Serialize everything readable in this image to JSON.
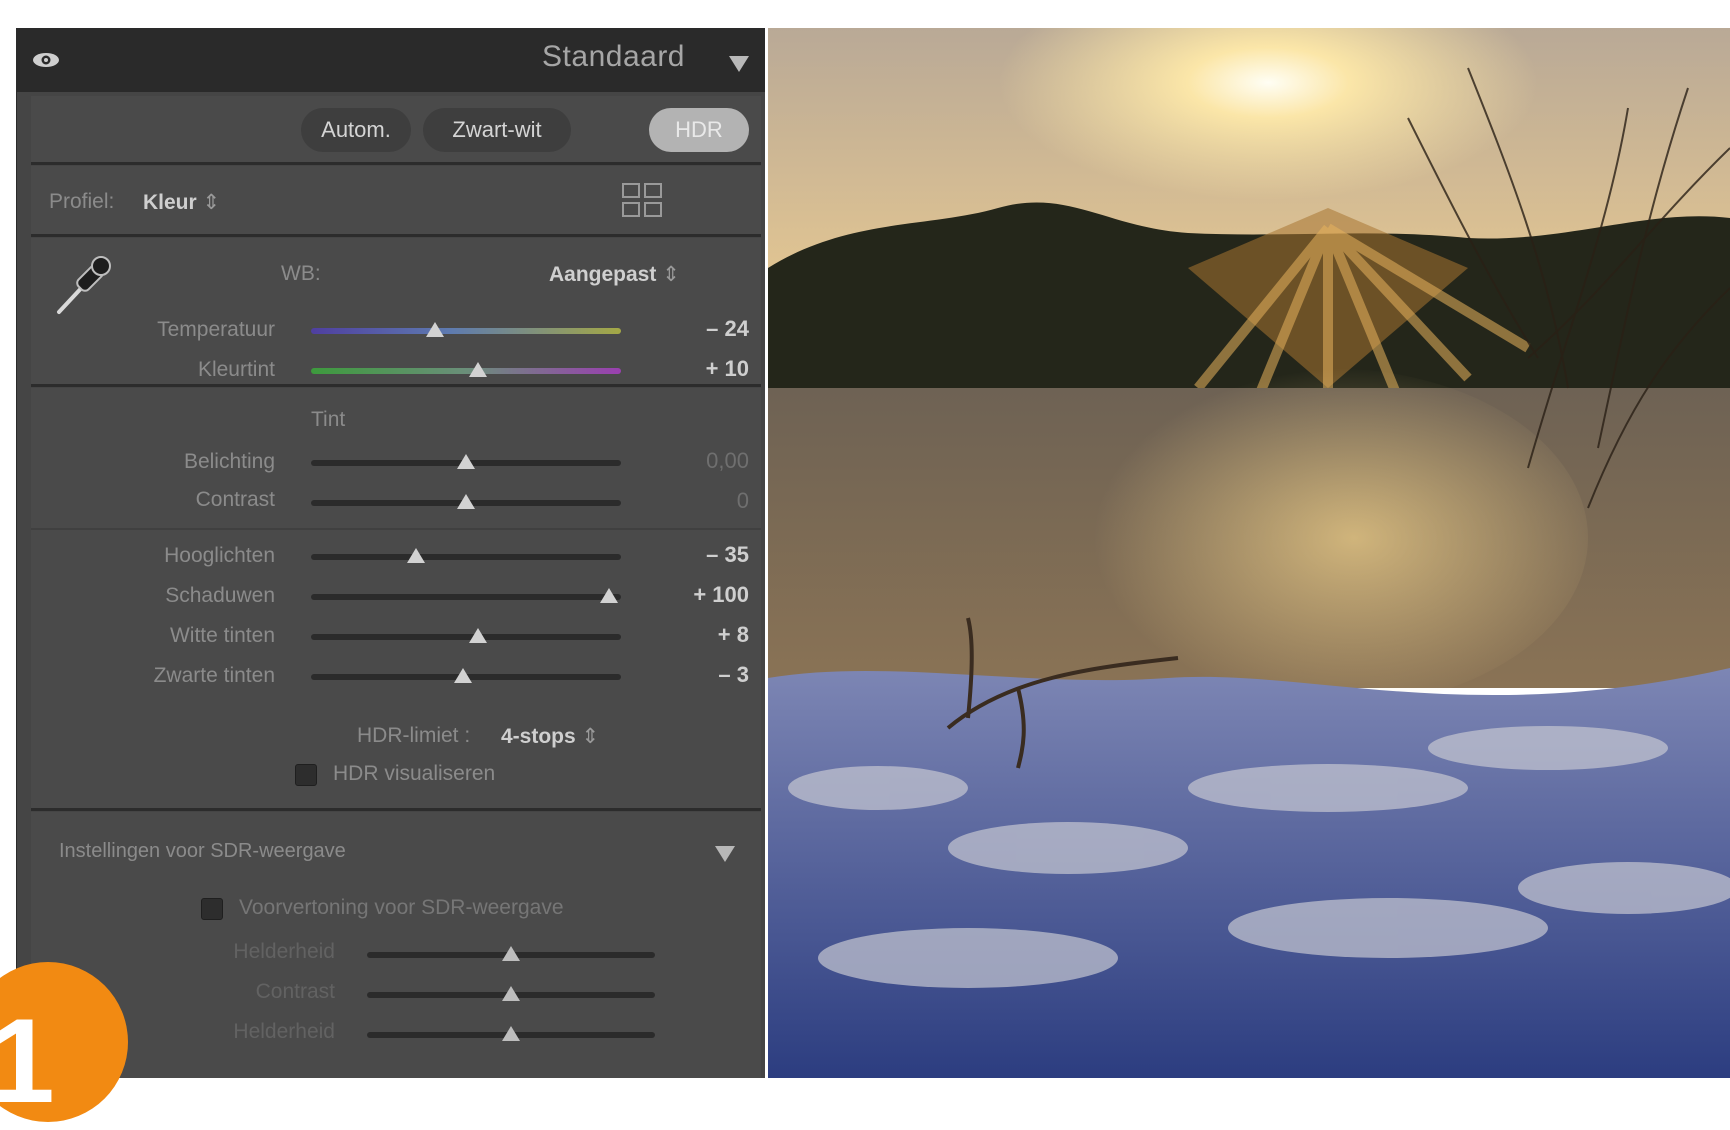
{
  "header": {
    "preset": "Standaard"
  },
  "mode_buttons": {
    "auto": "Autom.",
    "bw": "Zwart-wit",
    "hdr": "HDR"
  },
  "profile": {
    "label": "Profiel:",
    "value": "Kleur"
  },
  "wb": {
    "label": "WB:",
    "value": "Aangepast",
    "sliders": [
      {
        "label": "Temperatuur",
        "value": "– 24",
        "level": 0.4
      },
      {
        "label": "Kleurtint",
        "value": "+ 10",
        "level": 0.54
      }
    ]
  },
  "tone": {
    "title": "Tint",
    "sliders": [
      {
        "label": "Belichting",
        "value": "0,00",
        "level": 0.5
      },
      {
        "label": "Contrast",
        "value": "0",
        "level": 0.5
      },
      {
        "label": "Hooglichten",
        "value": "– 35",
        "level": 0.34
      },
      {
        "label": "Schaduwen",
        "value": "+ 100",
        "level": 0.96
      },
      {
        "label": "Witte tinten",
        "value": "+ 8",
        "level": 0.54
      },
      {
        "label": "Zwarte tinten",
        "value": "– 3",
        "level": 0.49
      }
    ]
  },
  "hdr": {
    "limit_label": "HDR-limiet :",
    "limit_value": "4-stops",
    "visualize_label": "HDR visualiseren"
  },
  "sdr": {
    "title": "Instellingen voor SDR-weergave",
    "preview_label": "Voorvertoning voor SDR-weergave",
    "sliders": [
      {
        "label": "Helderheid",
        "level": 0.5
      },
      {
        "label": "Contrast",
        "level": 0.5
      },
      {
        "label": "Helderheid",
        "level": 0.5
      }
    ]
  },
  "badge": "1"
}
